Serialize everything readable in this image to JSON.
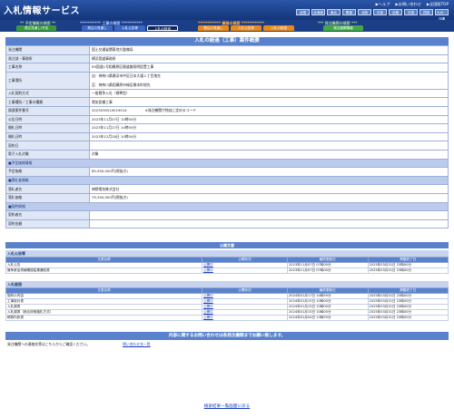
{
  "header": {
    "logo": "入札情報サービス",
    "top_links": [
      "ヘルプ",
      "お問い合わせ",
      "全国版TOP"
    ],
    "regions": [
      "全国",
      "北海道",
      "東北",
      "関東",
      "北陸",
      "中部",
      "近畿",
      "中国",
      "四国",
      "九州・沖縄"
    ]
  },
  "nav": {
    "sections": [
      {
        "label": "** 予定情報の検索 **"
      },
      {
        "label": "*********** 工事の検索 ***********"
      },
      {
        "label": "************ 業務の検索 ************"
      },
      {
        "label": "*** 発注機関の検索 ***"
      }
    ],
    "tabs": [
      "発注見通し/予定",
      "発注の見通し",
      "入札公告等",
      "入札の経過",
      "発注の見通し",
      "入札公告等",
      "入札の経過",
      "発注機関情報"
    ]
  },
  "detail": {
    "title": "入札の経過（工事）案件概要",
    "rows": [
      {
        "label": "発注機関",
        "value": "国土交通省関東地方整備局"
      },
      {
        "label": "発注部・事務所",
        "value": "横浜国道事務所"
      },
      {
        "label": "工事名称",
        "value": "R5国道1号相模原区間道路照明設置工事"
      },
      {
        "label": "工事場所",
        "value": "自：神奈川県横浜市中区日本大通１丁目地先",
        "value2": "至：神奈川県相模原市緑区橋本町地先"
      },
      {
        "label": "入札契約方式",
        "value": "一般競争入札（標準型）"
      },
      {
        "label": "工事種別／工事の種類",
        "value": "電気設備工事"
      },
      {
        "label": "調達案件番号",
        "value": "2023030510019014",
        "note": "※発注機関が独自に定めるコード"
      },
      {
        "label": "公告日時",
        "value": "2023年11月07日 10時00分"
      },
      {
        "label": "開札日時",
        "value": "2023年11月27日 10時00分"
      },
      {
        "label": "開札日時",
        "value": "2023年12月28日 10時00分"
      },
      {
        "label": "契約日",
        "value": ""
      },
      {
        "label": "電子入札対象",
        "value": "対象"
      }
    ],
    "estimate_header": "■予定価格情報",
    "estimate": {
      "label": "予定価格",
      "value": "85,950,000円(税抜き)"
    },
    "winner_header": "■落札者情報",
    "winner": [
      {
        "label": "落札者名",
        "value": "神野電気株式会社"
      },
      {
        "label": "落札価格",
        "value": "79,300,000円(税抜き)"
      }
    ],
    "contract_header": "■契約情報",
    "contract": [
      {
        "label": "契約者名",
        "value": ""
      },
      {
        "label": "契約金額",
        "value": ""
      }
    ]
  },
  "documents": {
    "title": "公開文書",
    "columns": [
      "文書名称",
      "公開状況",
      "最終更新日",
      "掲載終了日"
    ],
    "groups": [
      {
        "name": "入札公告等",
        "items": [
          {
            "name": "入札公告",
            "status": "公開中",
            "updated": "2023年11月07日 07時00分",
            "end": "2025年03月31日 23時00分"
          },
          {
            "name": "競争参加資格確認結果通知書",
            "status": "公開中",
            "updated": "2023年11月07日 07時00分",
            "end": "2025年03月31日 23時00分"
          }
        ]
      },
      {
        "name": "入札経過",
        "items": [
          {
            "name": "契約の内容",
            "status": "公開中",
            "updated": "2024年01月17日 14時59分",
            "end": "2025年03月31日 23時00分"
          },
          {
            "name": "工事設計書",
            "status": "公開中",
            "updated": "2024年01月15日 10時00分",
            "end": "2025年03月31日 23時00分"
          },
          {
            "name": "入札調書",
            "status": "公開中",
            "updated": "2024年01月15日 10時00分",
            "end": "2025年03月31日 23時00分"
          },
          {
            "name": "入札調書（総合評価落札方式）",
            "status": "公開中",
            "updated": "2024年01月15日 10時00分",
            "end": "2025年03月31日 23時00分"
          },
          {
            "name": "積算内訳書",
            "status": "公開中",
            "updated": "2024年01月04日 13時59分",
            "end": "2025年03月31日 23時00分"
          }
        ]
      }
    ]
  },
  "contact": {
    "banner": "内容に関するお問い合わせは各発注機関までお願い致します。",
    "text": "発注機関への連絡先等はこちらからご確認ください。",
    "link": "問い合わせ先一覧"
  },
  "back_link": "検索結果一覧画面に戻る"
}
